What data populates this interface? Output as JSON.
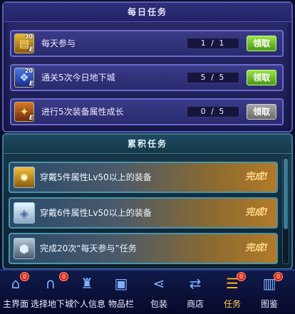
{
  "daily": {
    "title": "每日任务",
    "rows": [
      {
        "label": "每天参与",
        "progress": "1 / 1",
        "button": "领取",
        "icon": "gold-scroll-icon",
        "icon_num": "30",
        "icon_badge": "E"
      },
      {
        "label": "通关5次今日地下城",
        "progress": "5 / 5",
        "button": "领取",
        "icon": "blue-crystal-icon",
        "icon_num": "20",
        "icon_badge": "E"
      },
      {
        "label": "进行5次装备属性成长",
        "progress": "0 / 5",
        "button": "领取",
        "icon": "orange-badge-icon",
        "icon_num": "",
        "icon_badge": "E"
      }
    ]
  },
  "cumulative": {
    "title": "累积任务",
    "rows": [
      {
        "label": "穿戴5件属性Lv50以上的装备",
        "status": "完成!",
        "icon": "gold-emblem-icon"
      },
      {
        "label": "穿戴6件属性Lv50以上的装备",
        "status": "完成!",
        "icon": "white-gem-icon"
      },
      {
        "label": "完成20次“每天参与”任务",
        "status": "完成!",
        "icon": "silver-shield-icon"
      }
    ]
  },
  "nav": [
    {
      "label": "主界面",
      "icon": "home-icon",
      "badge": "0"
    },
    {
      "label": "选择地下城",
      "icon": "gate-icon",
      "badge": "0"
    },
    {
      "label": "个人信息",
      "icon": "character-icon",
      "badge": ""
    },
    {
      "label": "物品栏",
      "icon": "chest-icon",
      "badge": ""
    },
    {
      "label": "包装",
      "icon": "share-icon",
      "badge": ""
    },
    {
      "label": "商店",
      "icon": "exchange-icon",
      "badge": ""
    },
    {
      "label": "任务",
      "icon": "quest-scroll-icon",
      "badge": "0"
    },
    {
      "label": "图鉴",
      "icon": "book-icon",
      "badge": "0"
    }
  ],
  "colors": {
    "claim_active": "#6cc02c",
    "claim_disabled": "#8a8a8a",
    "nav_active": "#ffb020"
  }
}
